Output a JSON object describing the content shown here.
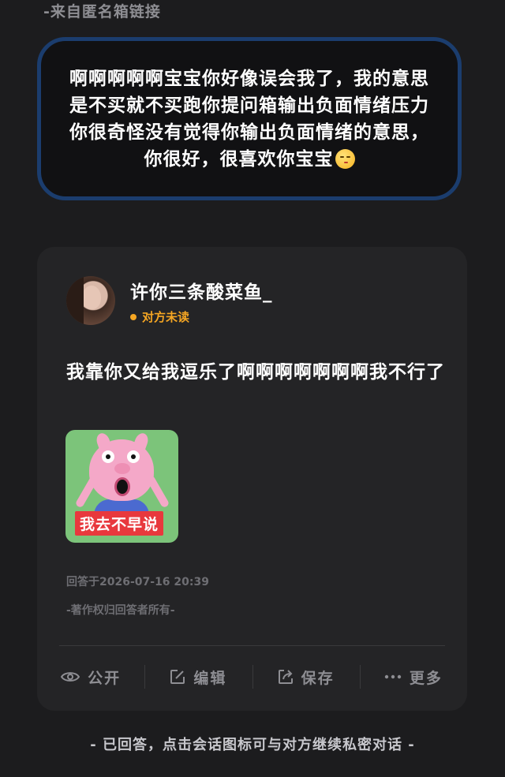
{
  "header": {
    "source_label": "-来自匿名箱链接"
  },
  "question": {
    "text": "啊啊啊啊啊宝宝你好像误会我了，我的意思是不买就不买跑你提问箱输出负面情绪压力你很奇怪没有觉得你输出负面情绪的意思，你很好，很喜欢你宝宝",
    "emoji": "kissing-face-emoji"
  },
  "answer": {
    "username": "许你三条酸菜鱼_",
    "status": "对方未读",
    "status_color": "#f5a623",
    "text": "我靠你又给我逗乐了啊啊啊啊啊啊啊我不行了",
    "sticker_caption": "我去不早说",
    "answered_at": "回答于2026-07-16 20:39",
    "copyright": "-著作权归回答者所有-"
  },
  "actions": {
    "public_label": "公开",
    "edit_label": "编辑",
    "save_label": "保存",
    "more_label": "更多"
  },
  "footer": {
    "hint": "- 已回答，点击会话图标可与对方继续私密对话 -"
  },
  "colors": {
    "background": "#1c1c1e",
    "card": "#242426",
    "question_border": "#1b3d6e"
  }
}
